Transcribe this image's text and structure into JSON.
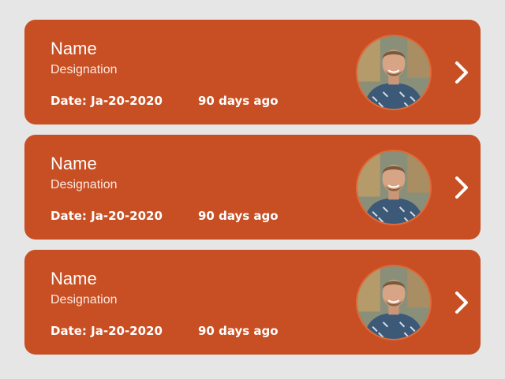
{
  "cards": [
    {
      "name": "Name",
      "designation": "Designation",
      "date": "Date: Ja-20-2020",
      "ago": "90 days ago",
      "avatar_icon": "person-photo",
      "chevron_icon": "chevron-right-icon"
    },
    {
      "name": "Name",
      "designation": "Designation",
      "date": "Date: Ja-20-2020",
      "ago": "90 days ago",
      "avatar_icon": "person-photo",
      "chevron_icon": "chevron-right-icon"
    },
    {
      "name": "Name",
      "designation": "Designation",
      "date": "Date: Ja-20-2020",
      "ago": "90 days ago",
      "avatar_icon": "person-photo",
      "chevron_icon": "chevron-right-icon"
    }
  ],
  "colors": {
    "background": "#e6e6e6",
    "card": "#c84f23",
    "text": "#ffffff"
  }
}
